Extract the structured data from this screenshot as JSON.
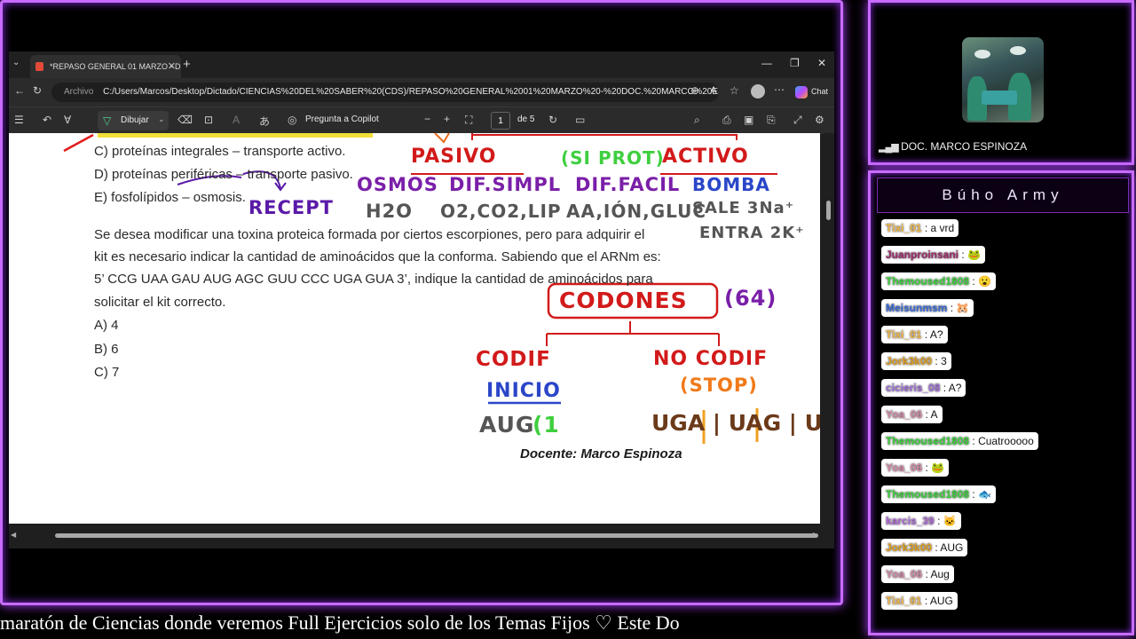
{
  "browser": {
    "tab_title": "*REPASO GENERAL 01 MARZO - D",
    "address_scheme": "Archivo",
    "address": "C:/Users/Marcos/Desktop/Dictado/CIENCIAS%20DEL%20SABER%20(CDS)/REPASO%20GENERAL%2001%20MARZO%20-%20DOC.%20MARCO%20ESPIN...",
    "chat_button": "Chat",
    "toolbar": {
      "draw_label": "Dibujar",
      "copilot_label": "Pregunta a Copilot",
      "page_current": "1",
      "page_total": "de 5"
    }
  },
  "document": {
    "option_c_top": "C) proteínas integrales – transporte activo.",
    "option_d_prefix": "D) proteínas ",
    "option_d_underlined": "periféricas",
    "option_d_suffix": " – transporte pasivo.",
    "option_e": "E) fosfolípidos – osmosis.",
    "question_lines": [
      "Se desea modificar una toxina proteica formada por ciertos escorpiones, pero para adquirir el",
      "kit es necesario indicar la cantidad de aminoácidos que la conforma. Sabiendo que el ARNm es:",
      "5’ CCG UAA GAU AUG AGC GUU CCC UGA GUA 3’, indique la cantidad de aminoácidos para",
      "solicitar el kit correcto."
    ],
    "answers": [
      "A) 4",
      "B) 6",
      "C) 7"
    ],
    "footer": "Docente: Marco Espinoza"
  },
  "annotations": {
    "pasivo": "PASIVO",
    "siprot": "(SI PROT)",
    "activo": "ACTIVO",
    "osmos": "OSMOS",
    "difsimpl": "DIF.SIMPL",
    "diffacil": "DIF.FACIL",
    "bomba": "BOMBA",
    "recept": "RECEPT",
    "h2o": "H2O",
    "o2": "O2,CO2,LIP",
    "aa": "AA,IÓN,GLUC",
    "sale": "SALE 3Na⁺",
    "entra": "ENTRA 2K⁺",
    "codones": "CODONES",
    "count64": "(64)",
    "codif": "CODIF",
    "nocodif": "NO CODIF",
    "inicio": "INICIO",
    "stop": "(STOP)",
    "aug": "AUG",
    "aug_bracket": "(1",
    "stops": "UGA | UAG | UAA"
  },
  "stream": {
    "camera_label": "DOC. MARCO ESPINOZA",
    "chat_title": "Búho Army",
    "ticker": "maratón de Ciencias donde veremos Full Ejercicios solo de los Temas Fijos      ♡      Este Do"
  },
  "chat": [
    {
      "user": "Tixi_01",
      "text": "a vrd",
      "color": "#f0b64a",
      "emoji": ""
    },
    {
      "user": "Juanproinsani",
      "text": "",
      "color": "#9c2a6a",
      "emoji": "🐸"
    },
    {
      "user": "Themoused1808",
      "text": "",
      "color": "#3bd13b",
      "emoji": "😮"
    },
    {
      "user": "Meisunmsm",
      "text": "",
      "color": "#3a6bd6",
      "emoji": "🐹"
    },
    {
      "user": "Tixi_01",
      "text": "A?",
      "color": "#f0b64a",
      "emoji": ""
    },
    {
      "user": "Jork3k00",
      "text": "3",
      "color": "#e0a020",
      "emoji": ""
    },
    {
      "user": "cicieris_08",
      "text": "A?",
      "color": "#a070d8",
      "emoji": ""
    },
    {
      "user": "Yoa_06",
      "text": "A",
      "color": "#d48aa8",
      "emoji": ""
    },
    {
      "user": "Themoused1808",
      "text": "Cuatrooooo",
      "color": "#3bd13b",
      "emoji": ""
    },
    {
      "user": "Yoa_06",
      "text": "",
      "color": "#d48aa8",
      "emoji": "🐸"
    },
    {
      "user": "Themoused1808",
      "text": "",
      "color": "#3bd13b",
      "emoji": "🐟"
    },
    {
      "user": "karcis_39",
      "text": "",
      "color": "#b06ad8",
      "emoji": "🐱"
    },
    {
      "user": "Jork3k00",
      "text": "AUG",
      "color": "#e0a020",
      "emoji": ""
    },
    {
      "user": "Yoa_06",
      "text": "Aug",
      "color": "#d48aa8",
      "emoji": ""
    },
    {
      "user": "Tixi_01",
      "text": "AUG",
      "color": "#f0b64a",
      "emoji": ""
    }
  ]
}
